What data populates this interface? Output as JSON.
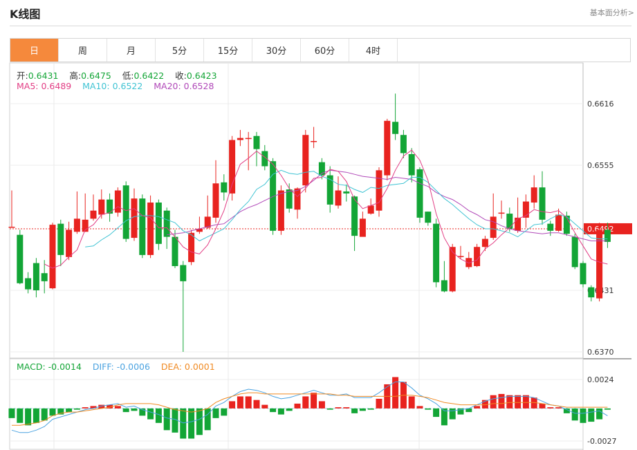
{
  "header": {
    "title": "K线图",
    "link": "基本面分析>"
  },
  "tabs": [
    "日",
    "周",
    "月",
    "5分",
    "15分",
    "30分",
    "60分",
    "4时"
  ],
  "active_tab": 0,
  "ohlc_info": {
    "open_label": "开:",
    "open": "0.6431",
    "high_label": "高:",
    "high": "0.6475",
    "low_label": "低:",
    "low": "0.6422",
    "close_label": "收:",
    "close": "0.6423"
  },
  "ma_info": {
    "ma5_label": "MA5: ",
    "ma5": "0.6489",
    "ma10_label": "MA10: ",
    "ma10": "0.6522",
    "ma20_label": "MA20: ",
    "ma20": "0.6528"
  },
  "macd_info": {
    "macd_label": "MACD: ",
    "macd": "-0.0014",
    "diff_label": "DIFF: ",
    "diff": "-0.0006",
    "dea_label": "DEA: ",
    "dea": "0.0001"
  },
  "colors": {
    "up": "#e8231f",
    "down": "#13a536",
    "ma5": "#e23d84",
    "ma10": "#3fc3d3",
    "ma20": "#b048b8",
    "diff": "#4aa2e0",
    "dea": "#f08a22",
    "accent": "#f5893c"
  },
  "chart_data": {
    "type": "candlestick",
    "y_ticks": [
      "0.6616",
      "0.6555",
      "0.6492",
      "0.6431",
      "0.6370"
    ],
    "ylim": [
      0.6364,
      0.6657
    ],
    "current_price": "0.6492",
    "candles": [
      [
        0.6494,
        0.6494,
        0.653,
        0.6494
      ],
      [
        0.6486,
        0.6438,
        0.6491,
        0.6437
      ],
      [
        0.6443,
        0.6432,
        0.6449,
        0.6428
      ],
      [
        0.6458,
        0.6431,
        0.6463,
        0.6424
      ],
      [
        0.6448,
        0.644,
        0.6461,
        0.6428
      ],
      [
        0.6433,
        0.6496,
        0.6498,
        0.6432
      ],
      [
        0.6497,
        0.6466,
        0.6501,
        0.6455
      ],
      [
        0.6464,
        0.6491,
        0.6499,
        0.6461
      ],
      [
        0.6489,
        0.6502,
        0.6529,
        0.6487
      ],
      [
        0.6489,
        0.6501,
        0.6527,
        0.6489
      ],
      [
        0.6502,
        0.651,
        0.6526,
        0.65
      ],
      [
        0.6506,
        0.6521,
        0.6531,
        0.6502
      ],
      [
        0.6521,
        0.6507,
        0.6527,
        0.6499
      ],
      [
        0.6508,
        0.653,
        0.6533,
        0.6504
      ],
      [
        0.6535,
        0.6482,
        0.6539,
        0.6479
      ],
      [
        0.6483,
        0.6522,
        0.6532,
        0.648
      ],
      [
        0.6522,
        0.6466,
        0.6526,
        0.6463
      ],
      [
        0.6466,
        0.6518,
        0.6525,
        0.6463
      ],
      [
        0.6518,
        0.6477,
        0.6521,
        0.6471
      ],
      [
        0.651,
        0.6484,
        0.6513,
        0.6472
      ],
      [
        0.6484,
        0.6455,
        0.6491,
        0.6453
      ],
      [
        0.6456,
        0.644,
        0.646,
        0.637
      ],
      [
        0.6459,
        0.6488,
        0.6491,
        0.6456
      ],
      [
        0.6489,
        0.6492,
        0.6504,
        0.6487
      ],
      [
        0.6493,
        0.6504,
        0.6525,
        0.6492
      ],
      [
        0.6503,
        0.6537,
        0.656,
        0.6498
      ],
      [
        0.6538,
        0.6528,
        0.6546,
        0.652
      ],
      [
        0.6527,
        0.658,
        0.6584,
        0.652
      ],
      [
        0.658,
        0.6582,
        0.659,
        0.6574
      ],
      [
        0.6582,
        0.6582,
        0.6588,
        0.655
      ],
      [
        0.6584,
        0.6571,
        0.6588,
        0.6554
      ],
      [
        0.6569,
        0.6554,
        0.6575,
        0.655
      ],
      [
        0.6559,
        0.649,
        0.6562,
        0.6486
      ],
      [
        0.649,
        0.653,
        0.6535,
        0.6486
      ],
      [
        0.6531,
        0.6512,
        0.6537,
        0.6508
      ],
      [
        0.6511,
        0.6532,
        0.6533,
        0.6502
      ],
      [
        0.6535,
        0.6585,
        0.659,
        0.6528
      ],
      [
        0.6579,
        0.6579,
        0.6593,
        0.6572
      ],
      [
        0.6558,
        0.6545,
        0.6562,
        0.6541
      ],
      [
        0.6545,
        0.6516,
        0.6554,
        0.6508
      ],
      [
        0.6515,
        0.653,
        0.6544,
        0.6512
      ],
      [
        0.6529,
        0.6527,
        0.6536,
        0.6519
      ],
      [
        0.6524,
        0.6485,
        0.6525,
        0.647
      ],
      [
        0.6484,
        0.6502,
        0.6509,
        0.6487
      ],
      [
        0.6507,
        0.6515,
        0.6522,
        0.6506
      ],
      [
        0.651,
        0.655,
        0.6553,
        0.6504
      ],
      [
        0.6545,
        0.6599,
        0.6601,
        0.654
      ],
      [
        0.6598,
        0.6586,
        0.6626,
        0.658
      ],
      [
        0.6585,
        0.6567,
        0.659,
        0.6562
      ],
      [
        0.6566,
        0.6545,
        0.6572,
        0.6538
      ],
      [
        0.6551,
        0.6503,
        0.6553,
        0.6498
      ],
      [
        0.6509,
        0.6498,
        0.6509,
        0.6495
      ],
      [
        0.6497,
        0.6439,
        0.6502,
        0.6434
      ],
      [
        0.6441,
        0.643,
        0.646,
        0.6429
      ],
      [
        0.643,
        0.6474,
        0.6477,
        0.6429
      ],
      [
        0.6465,
        0.6465,
        0.6475,
        0.6462
      ],
      [
        0.6454,
        0.6463,
        0.6469,
        0.6452
      ],
      [
        0.6455,
        0.6474,
        0.6477,
        0.6454
      ],
      [
        0.6474,
        0.6482,
        0.6485,
        0.647
      ],
      [
        0.6483,
        0.6504,
        0.6527,
        0.6481
      ],
      [
        0.6508,
        0.6508,
        0.652,
        0.6502
      ],
      [
        0.6507,
        0.6492,
        0.6513,
        0.6489
      ],
      [
        0.649,
        0.6503,
        0.6523,
        0.6488
      ],
      [
        0.6503,
        0.6519,
        0.6526,
        0.6493
      ],
      [
        0.6518,
        0.6533,
        0.6545,
        0.6512
      ],
      [
        0.6533,
        0.6501,
        0.6549,
        0.6496
      ],
      [
        0.6497,
        0.649,
        0.65,
        0.6485
      ],
      [
        0.649,
        0.6506,
        0.6512,
        0.6489
      ],
      [
        0.6505,
        0.6487,
        0.6509,
        0.6485
      ],
      [
        0.6484,
        0.6454,
        0.6487,
        0.6452
      ],
      [
        0.6458,
        0.6437,
        0.646,
        0.6434
      ],
      [
        0.6434,
        0.6424,
        0.6436,
        0.642
      ],
      [
        0.6423,
        0.6491,
        0.6498,
        0.642
      ],
      [
        0.6491,
        0.6479,
        0.6498,
        0.6473
      ]
    ],
    "ma5": [
      null,
      null,
      null,
      null,
      0.6457,
      0.6453,
      0.6456,
      0.6464,
      0.6471,
      0.6491,
      0.6496,
      0.6506,
      0.6508,
      0.6514,
      0.651,
      0.6512,
      0.6505,
      0.6503,
      0.6493,
      0.6493,
      0.6484,
      0.6474,
      0.6469,
      0.6467,
      0.6476,
      0.6492,
      0.651,
      0.6536,
      0.6556,
      0.6562,
      0.6569,
      0.6563,
      0.6556,
      0.6545,
      0.6532,
      0.6524,
      0.6532,
      0.6542,
      0.6543,
      0.6551,
      0.6549,
      0.6539,
      0.6521,
      0.6512,
      0.6515,
      0.6518,
      0.6532,
      0.655,
      0.6564,
      0.657,
      0.656,
      0.654,
      0.6507,
      0.6483,
      0.6469,
      0.6462,
      0.6458,
      0.6461,
      0.6472,
      0.6478,
      0.6486,
      0.6493,
      0.6502,
      0.6505,
      0.6511,
      0.6509,
      0.6508,
      0.651,
      0.6503,
      0.6488,
      0.6475,
      0.6462,
      0.6459,
      0.6457
    ],
    "ma10": [
      null,
      null,
      null,
      null,
      null,
      null,
      null,
      null,
      null,
      0.6474,
      0.6475,
      0.6481,
      0.6486,
      0.6493,
      0.65,
      0.6504,
      0.6505,
      0.6505,
      0.6504,
      0.6501,
      0.6498,
      0.649,
      0.6486,
      0.648,
      0.6484,
      0.6488,
      0.6492,
      0.6501,
      0.6511,
      0.6519,
      0.6531,
      0.6536,
      0.6546,
      0.655,
      0.6547,
      0.6546,
      0.6548,
      0.6549,
      0.6544,
      0.6541,
      0.6536,
      0.6535,
      0.6531,
      0.6528,
      0.6533,
      0.6532,
      0.6535,
      0.6536,
      0.6537,
      0.6543,
      0.6543,
      0.6538,
      0.653,
      0.6522,
      0.6516,
      0.6509,
      0.6502,
      0.6496,
      0.6492,
      0.6492,
      0.649,
      0.6488,
      0.6484,
      0.649,
      0.6496,
      0.6497,
      0.6502,
      0.6506,
      0.6504,
      0.6497,
      0.649,
      0.6483,
      0.6482,
      0.6482
    ],
    "ma20": [
      null,
      null,
      null,
      null,
      null,
      null,
      null,
      null,
      null,
      null,
      null,
      null,
      null,
      null,
      null,
      null,
      null,
      null,
      null,
      0.6486,
      0.6487,
      0.6488,
      0.649,
      0.6492,
      0.6494,
      0.6496,
      0.6497,
      0.6503,
      0.6509,
      0.6513,
      0.6516,
      0.652,
      0.6524,
      0.6527,
      0.6529,
      0.653,
      0.6534,
      0.654,
      0.6547,
      0.655,
      0.6549,
      0.6548,
      0.6546,
      0.6544,
      0.6543,
      0.6542,
      0.6541,
      0.6543,
      0.6542,
      0.6541,
      0.6537,
      0.6534,
      0.6528,
      0.6524,
      0.6521,
      0.6516,
      0.651,
      0.6506,
      0.6501,
      0.6499,
      0.6495,
      0.6492,
      0.649,
      0.6489,
      0.6488,
      0.6487,
      0.6488,
      0.6488,
      0.6486,
      0.6484,
      0.6482,
      0.648,
      0.648,
      0.648
    ],
    "macd": {
      "y_ticks": [
        "0.0024",
        "-0.0027"
      ],
      "ylim": [
        -0.0028,
        0.0032
      ],
      "hist": [
        -0.0008,
        -0.0012,
        -0.0014,
        -0.0012,
        -0.001,
        -0.0006,
        -0.0005,
        -0.0003,
        -0.0001,
        0.0001,
        0.0002,
        0.0003,
        0.0003,
        0.0002,
        -0.0003,
        -0.0002,
        -0.0006,
        -0.0009,
        -0.0012,
        -0.0018,
        -0.002,
        -0.0025,
        -0.0025,
        -0.0022,
        -0.0018,
        -0.0008,
        -0.0006,
        0.0006,
        0.001,
        0.001,
        0.0007,
        0.0003,
        -0.0003,
        -0.0005,
        -0.0002,
        0.0004,
        0.001,
        0.0013,
        0.0006,
        -0.0001,
        0.0001,
        0.0001,
        -0.0004,
        -0.0002,
        -0.0001,
        0.0008,
        0.002,
        0.0026,
        0.0022,
        0.001,
        0.0002,
        -0.0001,
        -0.0007,
        -0.0014,
        -0.0009,
        -0.0005,
        -0.0003,
        0.0002,
        0.0007,
        0.0011,
        0.0012,
        0.0011,
        0.0011,
        0.0011,
        0.0009,
        0.0004,
        0.0001,
        0.0001,
        -0.0004,
        -0.001,
        -0.0012,
        -0.0011,
        -0.0009,
        -0.0001
      ],
      "diff": [
        -0.0018,
        -0.002,
        -0.002,
        -0.0018,
        -0.0015,
        -0.0009,
        -0.0007,
        -0.0005,
        -0.0003,
        -0.0001,
        0.0,
        0.0002,
        0.0003,
        0.0004,
        0.0001,
        0.0002,
        -0.0001,
        -0.0003,
        -0.0005,
        -0.0008,
        -0.0009,
        -0.0012,
        -0.0011,
        -0.0009,
        -0.0005,
        0.0002,
        0.0005,
        0.001,
        0.0014,
        0.0016,
        0.0015,
        0.0013,
        0.001,
        0.0008,
        0.0009,
        0.0011,
        0.0013,
        0.0015,
        0.0013,
        0.0011,
        0.0011,
        0.0012,
        0.0009,
        0.0009,
        0.0009,
        0.0013,
        0.0018,
        0.0022,
        0.0022,
        0.0017,
        0.0011,
        0.0008,
        0.0004,
        -0.0002,
        -0.0002,
        -0.0001,
        0.0,
        0.0003,
        0.0006,
        0.0008,
        0.0009,
        0.001,
        0.001,
        0.001,
        0.0009,
        0.0006,
        0.0003,
        0.0002,
        -0.0001,
        -0.0004,
        -0.0004,
        -0.0003,
        -0.0002,
        -0.0006
      ],
      "dea": [
        -0.0014,
        -0.0014,
        -0.0013,
        -0.0012,
        -0.001,
        -0.0006,
        -0.0004,
        -0.0003,
        -0.0003,
        -0.0002,
        -0.0001,
        0.0,
        0.0001,
        0.0003,
        0.0004,
        0.0004,
        0.0004,
        0.0004,
        0.0003,
        0.0001,
        -0.0001,
        -0.0002,
        -0.0003,
        -0.0002,
        0.0,
        0.0005,
        0.0008,
        0.001,
        0.0012,
        0.0013,
        0.0013,
        0.0012,
        0.0012,
        0.0012,
        0.0012,
        0.0012,
        0.0012,
        0.0012,
        0.0012,
        0.0012,
        0.0011,
        0.0011,
        0.001,
        0.001,
        0.001,
        0.001,
        0.001,
        0.001,
        0.0011,
        0.0011,
        0.001,
        0.0009,
        0.0007,
        0.0005,
        0.0004,
        0.0003,
        0.0003,
        0.0003,
        0.0003,
        0.0004,
        0.0004,
        0.0005,
        0.0005,
        0.0005,
        0.0005,
        0.0004,
        0.0003,
        0.0002,
        0.0001,
        0.0001,
        0.0001,
        0.0001,
        0.0001,
        0.0001
      ]
    }
  }
}
